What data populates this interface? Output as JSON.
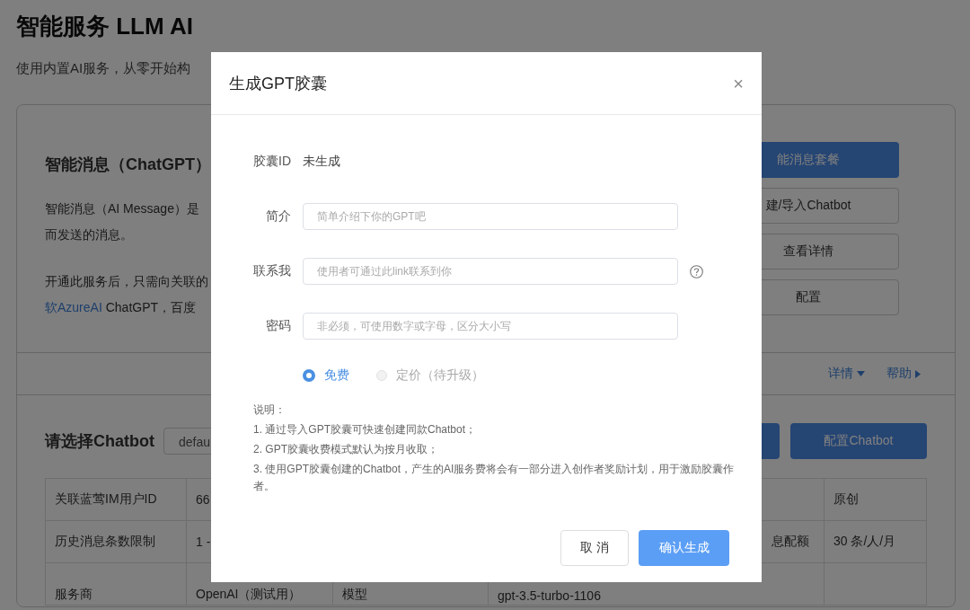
{
  "page": {
    "title": "智能服务 LLM AI",
    "subtitle": "使用内置AI服务，从零开始构"
  },
  "service_card": {
    "title": "智能消息（ChatGPT）",
    "paragraphs": [
      [
        [
          {
            "kind": "text",
            "text": "智能消息（AI Message）是"
          }
        ],
        [
          {
            "kind": "text",
            "text": "而发送的消息。"
          }
        ]
      ],
      [
        [
          {
            "kind": "text",
            "text": "开通此服务后，只需向关联的"
          }
        ],
        [
          {
            "kind": "link",
            "text": "软AzureAI"
          },
          {
            "kind": "text",
            "text": " ChatGPT，百度"
          }
        ]
      ]
    ],
    "buttons": [
      {
        "label": "能消息套餐",
        "kind": "primary"
      },
      {
        "label": "建/导入Chatbot",
        "kind": "default"
      },
      {
        "label": "查看详情",
        "kind": "default"
      },
      {
        "label": "配置",
        "kind": "default"
      }
    ],
    "links": [
      {
        "label": "详情",
        "kind": "dropdown"
      },
      {
        "label": "帮助",
        "kind": "forward"
      }
    ]
  },
  "chatbot_section": {
    "title": "请选择Chatbot",
    "select_value": "defau",
    "buttons": [
      {
        "label": "配置Chatbot",
        "kind": "primary"
      }
    ],
    "table_rows": [
      [
        "关联蓝莺IM用户ID",
        "66",
        null,
        null,
        null,
        "原创"
      ],
      [
        "历史消息条数限制",
        "1 -",
        null,
        null,
        "息配额",
        "30 条/人/月"
      ],
      [
        "服务商",
        "OpenAI（测试用）",
        "模型",
        "gpt-3.5-turbo-1106",
        null,
        null
      ]
    ]
  },
  "modal": {
    "title": "生成GPT胶囊",
    "close": "×",
    "fields": [
      {
        "kind": "static",
        "label": "胶囊ID",
        "value": "未生成",
        "help": false
      },
      {
        "kind": "input",
        "label": "简介",
        "placeholder": "简单介绍下你的GPT吧",
        "help": false
      },
      {
        "kind": "input",
        "label": "联系我",
        "placeholder": "使用者可通过此link联系到你",
        "help": true
      },
      {
        "kind": "input",
        "label": "密码",
        "placeholder": "非必须，可使用数字或字母，区分大小写",
        "help": false
      }
    ],
    "pricing": [
      {
        "label": "免费",
        "selected": true,
        "disabled": false
      },
      {
        "label": "定价（待升级）",
        "selected": false,
        "disabled": true
      }
    ],
    "notes": [
      "说明：",
      "1. 通过导入GPT胶囊可快速创建同款Chatbot；",
      "2. GPT胶囊收费模式默认为按月收取；",
      "3. 使用GPT胶囊创建的Chatbot，产生的AI服务费将会有一部分进入创作者奖励计划，用于激励胶囊作者。"
    ],
    "buttons": [
      {
        "label": "取 消",
        "kind": "default"
      },
      {
        "label": "确认生成",
        "kind": "primary"
      }
    ]
  }
}
